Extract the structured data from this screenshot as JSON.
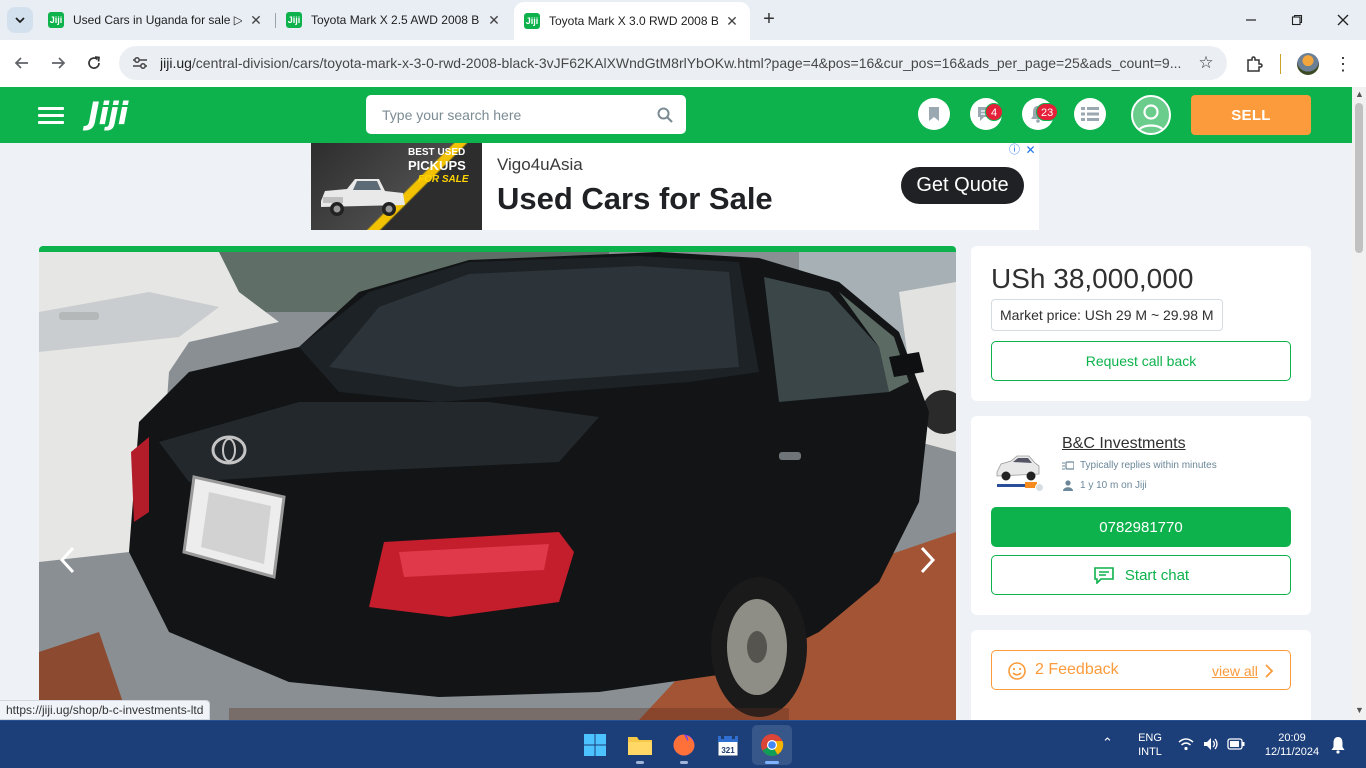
{
  "browser": {
    "tabs": [
      {
        "title": "Used Cars in Uganda for sale ▷",
        "favicon": "jiji-icon",
        "active": false
      },
      {
        "title": "Toyota Mark X 2.5 AWD 2008 B",
        "favicon": "jiji-icon",
        "active": false
      },
      {
        "title": "Toyota Mark X 3.0 RWD 2008 B",
        "favicon": "jiji-icon",
        "active": true
      }
    ],
    "url_domain": "jiji.ug",
    "url_path": "/central-division/cars/toyota-mark-x-3-0-rwd-2008-black-3vJF62KAlXWndGtM8rlYbOKw.html?page=4&pos=16&cur_pos=16&ads_per_page=25&ads_count=9..."
  },
  "header": {
    "logo": "Jiji",
    "search_placeholder": "Type your search here",
    "messages_badge": "4",
    "notifications_badge": "23",
    "sell_label": "SELL",
    "brand_color": "#0db24c",
    "sell_color": "#fb9b3b"
  },
  "ad": {
    "image_line1": "BEST USED",
    "image_line2": "PICKUPS",
    "image_line3": "FOR SALE",
    "brand": "Vigo4uAsia",
    "title": "Used Cars for Sale",
    "cta": "Get Quote"
  },
  "listing": {
    "price": "USh 38,000,000",
    "market_price": "Market price: USh 29 M ~ 29.98 M",
    "request_callback": "Request call back"
  },
  "seller": {
    "name": "B&C Investments",
    "reply_time": "Typically replies within minutes",
    "on_jiji": "1 y 10 m on Jiji",
    "phone": "0782981770",
    "start_chat": "Start chat"
  },
  "feedback": {
    "label": "2 Feedback",
    "view_all": "view all"
  },
  "status_link": "https://jiji.ug/shop/b-c-investments-ltd",
  "taskbar": {
    "lang1": "ENG",
    "lang2": "INTL",
    "time": "20:09",
    "date": "12/11/2024"
  }
}
